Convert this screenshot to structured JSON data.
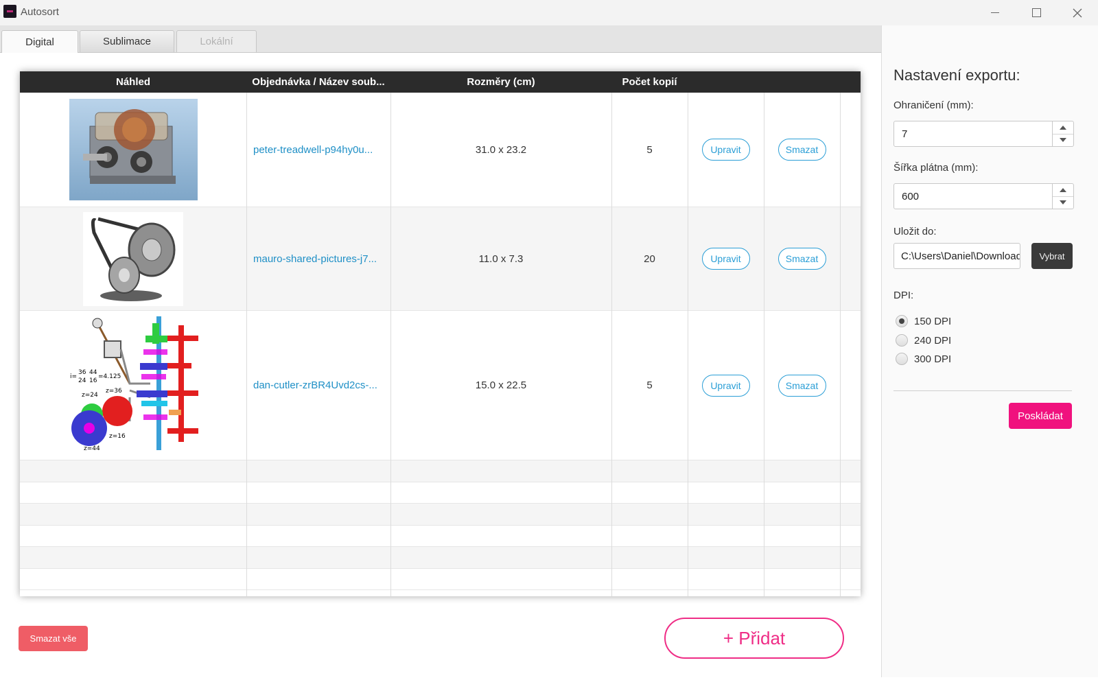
{
  "window": {
    "title": "Autosort"
  },
  "tabs": [
    {
      "label": "Digital"
    },
    {
      "label": "Sublimace"
    },
    {
      "label": "Lokální"
    }
  ],
  "table": {
    "columns": [
      "Náhled",
      "Objednávka / Název soub...",
      "Rozměry (cm)",
      "Počet kopií"
    ],
    "rows": [
      {
        "thumbnail": "gearbox-render",
        "filename": "peter-treadwell-p94hy0u...",
        "dimensions": "31.0 x 23.2",
        "copies": "5",
        "edit_label": "Upravit",
        "delete_label": "Smazat"
      },
      {
        "thumbnail": "belt-pulley-render",
        "filename": "mauro-shared-pictures-j7...",
        "dimensions": "11.0 x 7.3",
        "copies": "20",
        "edit_label": "Upravit",
        "delete_label": "Smazat"
      },
      {
        "thumbnail": "gear-diagram",
        "filename": "dan-cutler-zrBR4Uvd2cs-...",
        "dimensions": "15.0 x 22.5",
        "copies": "5",
        "edit_label": "Upravit",
        "delete_label": "Smazat"
      }
    ],
    "diagram_labels": {
      "i_num1": "36",
      "i_num2": "44",
      "i_den1": "24",
      "i_den2": "16",
      "i_result": "=4.125",
      "z24": "z=24",
      "z36": "z=36",
      "z16": "z=16",
      "z44": "z=44"
    }
  },
  "export": {
    "title": "Nastavení exportu:",
    "boundary_label": "Ohraničení (mm):",
    "boundary_value": "7",
    "canvas_width_label": "Šířka plátna (mm):",
    "canvas_width_value": "600",
    "save_to_label": "Uložit do:",
    "save_path": "C:\\Users\\Daniel\\Downloads",
    "browse_label": "Vybrat",
    "dpi_label": "DPI:",
    "dpi_options": [
      "150 DPI",
      "240 DPI",
      "300 DPI"
    ],
    "dpi_selected": "150 DPI",
    "arrange_label": "Poskládat"
  },
  "actions": {
    "delete_all_label": "Smazat vše",
    "add_label": "+ Přidat"
  },
  "colors": {
    "accent_pink": "#ef2d86",
    "link_blue": "#1e8fc6",
    "danger_red": "#ef5d66",
    "header_dark": "#2b2b2b"
  }
}
